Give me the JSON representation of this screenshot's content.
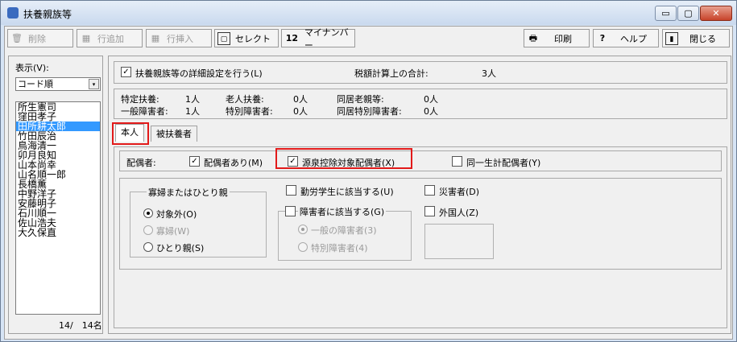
{
  "window": {
    "title": "扶養親族等",
    "min": "▭",
    "max": "▢",
    "close": "✕"
  },
  "toolbar": {
    "delete": "削除",
    "add_row": "行追加",
    "insert_row": "行挿入",
    "select": "セレクト",
    "mynumber_icon": "12",
    "mynumber": "マイナンバー",
    "print": "印刷",
    "help": "ヘルプ",
    "close": "閉じる"
  },
  "left": {
    "display_label": "表示(V):",
    "sort_value": "コード順",
    "names": [
      "所生憲司",
      "窪田孝子",
      "田所耕太郎",
      "竹田辰治",
      "鳥海清一",
      "卯月良知",
      "山本尚幸",
      "山名順一郎",
      "長橋薫",
      "中野洋子",
      "安藤明子",
      "石川順一",
      "佐山浩夫",
      "大久保直"
    ],
    "selected_index": 2,
    "count": "14/　14名"
  },
  "main": {
    "detail_checkbox": "扶養親族等の詳細設定を行う(L)",
    "tax_total_label": "税額計算上の合計:",
    "tax_total_value": "3人",
    "summary": [
      [
        "特定扶養:",
        "1人",
        "老人扶養:",
        "0人",
        "同居老親等:",
        "0人"
      ],
      [
        "一般障害者:",
        "1人",
        "特別障害者:",
        "0人",
        "同居特別障害者:",
        "0人"
      ]
    ],
    "tabs": [
      "本人",
      "被扶養者"
    ],
    "spouse_label": "配偶者:",
    "has_spouse": "配偶者あり(M)",
    "withholding_spouse": "源泉控除対象配偶者(X)",
    "same_household": "同一生計配偶者(Y)",
    "widow_group": "寡婦またはひとり親",
    "widow_options": [
      "対象外(O)",
      "寡婦(W)",
      "ひとり親(S)"
    ],
    "working_student": "勤労学生に該当する(U)",
    "disabled": "障害者に該当する(G)",
    "disabled_options": [
      "一般の障害者(3)",
      "特別障害者(4)"
    ],
    "disaster": "災害者(D)",
    "foreigner": "外国人(Z)",
    "checkmark": "✓"
  }
}
